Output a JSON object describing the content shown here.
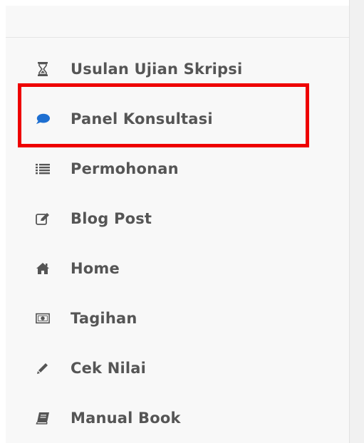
{
  "sidebar": {
    "items": [
      {
        "label": "Usulan Ujian Skripsi",
        "icon": "hourglass-icon"
      },
      {
        "label": "Panel Konsultasi",
        "icon": "comment-icon"
      },
      {
        "label": "Permohonan",
        "icon": "list-icon"
      },
      {
        "label": "Blog Post",
        "icon": "edit-icon"
      },
      {
        "label": "Home",
        "icon": "home-icon"
      },
      {
        "label": "Tagihan",
        "icon": "money-icon"
      },
      {
        "label": "Cek Nilai",
        "icon": "pencil-icon"
      },
      {
        "label": "Manual Book",
        "icon": "book-icon"
      }
    ]
  },
  "colors": {
    "text": "#555555",
    "icon": "#555555",
    "active_icon": "#1e6fd1",
    "highlight": "#ee0000",
    "sidebar_bg": "#f8f8f8"
  }
}
